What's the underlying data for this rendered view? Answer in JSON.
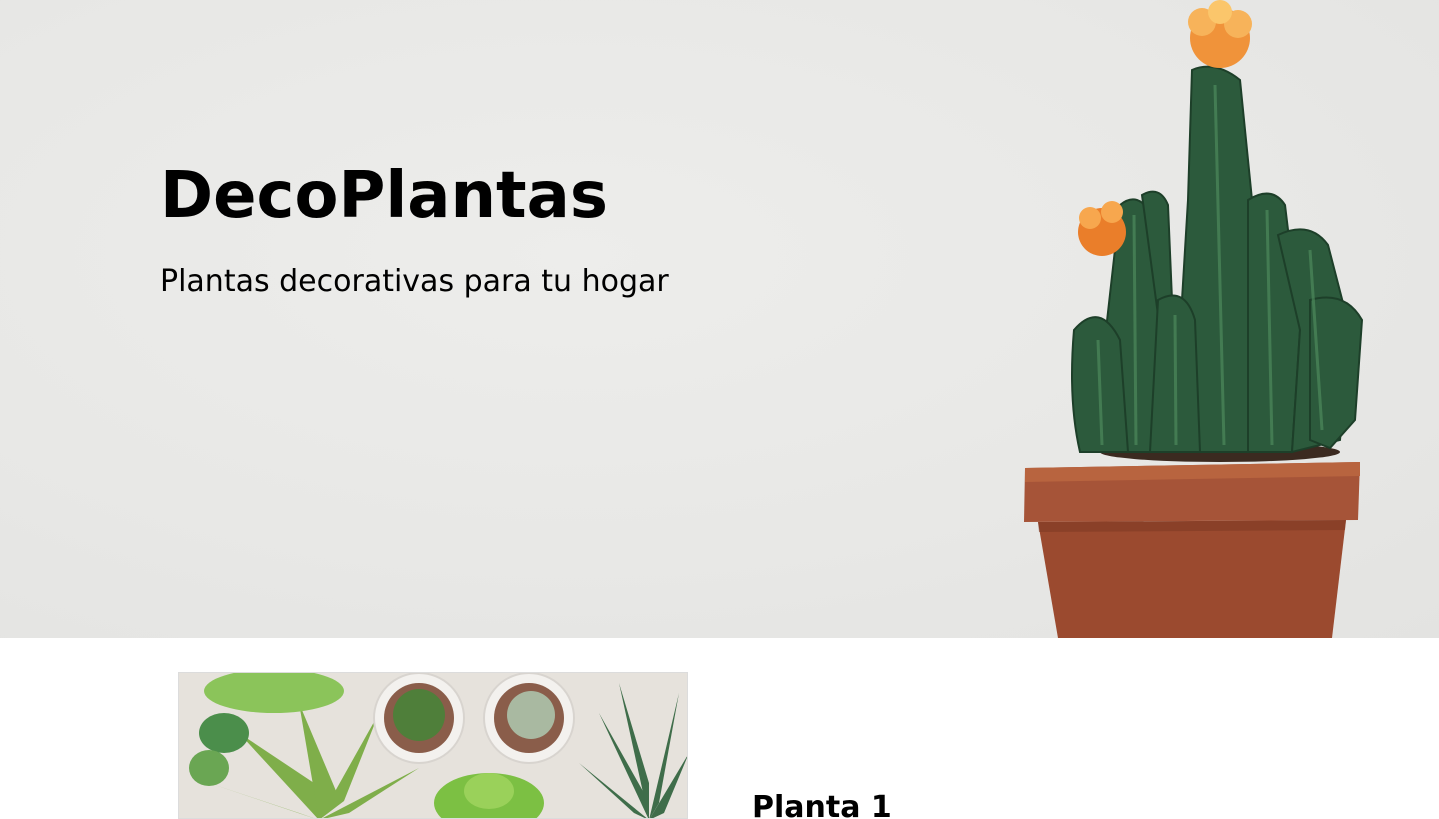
{
  "hero": {
    "title": "DecoPlantas",
    "subtitle": "Plantas decorativas para tu hogar",
    "background_color": "#e9e9e7",
    "image": "potted-cactus-with-orange-flowers"
  },
  "products": [
    {
      "name": "Planta 1",
      "image": "succulents-in-pots-top-view"
    }
  ],
  "colors": {
    "pot": "#a65438",
    "cactus": "#2c5a3c",
    "flower": "#f0933a"
  }
}
